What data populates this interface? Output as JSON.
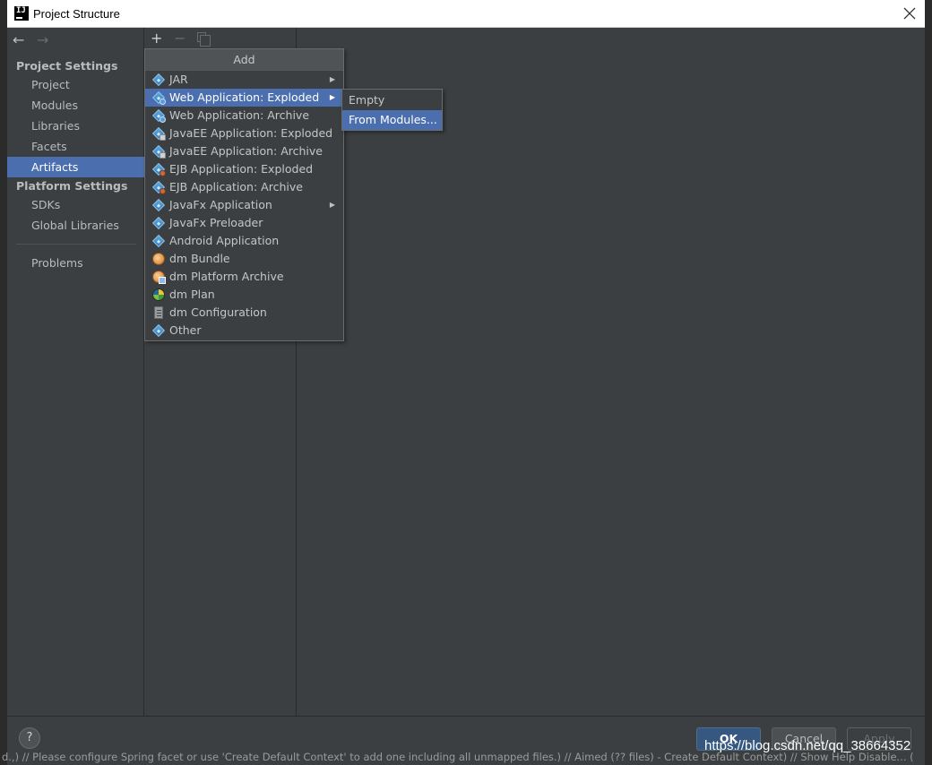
{
  "window": {
    "title": "Project Structure",
    "app_icon_text": "IJ"
  },
  "nav": {
    "back_icon": "←",
    "forward_icon": "→"
  },
  "sidebar": {
    "project_settings_header": "Project Settings",
    "project_settings_items": [
      "Project",
      "Modules",
      "Libraries",
      "Facets",
      "Artifacts"
    ],
    "platform_settings_header": "Platform Settings",
    "platform_settings_items": [
      "SDKs",
      "Global Libraries"
    ],
    "other_items": [
      "Problems"
    ],
    "selected": "Artifacts"
  },
  "toolbar": {
    "add_icon": "+",
    "remove_icon": "−"
  },
  "add_popup": {
    "title": "Add",
    "items": [
      {
        "label": "JAR",
        "icon": "artifact-icon",
        "submenu": true
      },
      {
        "label": "Web Application: Exploded",
        "icon": "web-artifact-icon",
        "submenu": true,
        "selected": true
      },
      {
        "label": "Web Application: Archive",
        "icon": "web-artifact-icon"
      },
      {
        "label": "JavaEE Application: Exploded",
        "icon": "javaee-artifact-icon"
      },
      {
        "label": "JavaEE Application: Archive",
        "icon": "javaee-artifact-icon"
      },
      {
        "label": "EJB Application: Exploded",
        "icon": "ejb-artifact-icon"
      },
      {
        "label": "EJB Application: Archive",
        "icon": "ejb-artifact-icon"
      },
      {
        "label": "JavaFx Application",
        "icon": "artifact-icon",
        "submenu": true
      },
      {
        "label": "JavaFx Preloader",
        "icon": "artifact-icon"
      },
      {
        "label": "Android Application",
        "icon": "artifact-icon"
      },
      {
        "label": "dm Bundle",
        "icon": "dm-bundle-icon"
      },
      {
        "label": "dm Platform Archive",
        "icon": "dm-archive-icon"
      },
      {
        "label": "dm Plan",
        "icon": "dm-plan-icon"
      },
      {
        "label": "dm Configuration",
        "icon": "dm-config-icon"
      },
      {
        "label": "Other",
        "icon": "artifact-icon"
      }
    ]
  },
  "submenu": {
    "items": [
      {
        "label": "Empty"
      },
      {
        "label": "From Modules...",
        "selected": true
      }
    ]
  },
  "buttons": {
    "help": "?",
    "ok": "OK",
    "cancel": "Cancel",
    "apply": "Apply"
  },
  "status_text": "d.,) // Please configure Spring facet or use 'Create Default Context' to add one including all unmapped files.) // Aimed (?? files) - Create Default Context) // Show Help Disable... (",
  "watermark": "https://blog.csdn.net/qq_38664352",
  "colors": {
    "selection": "#4b6eaf",
    "background": "#3c3f41",
    "ok_button": "#365880"
  }
}
